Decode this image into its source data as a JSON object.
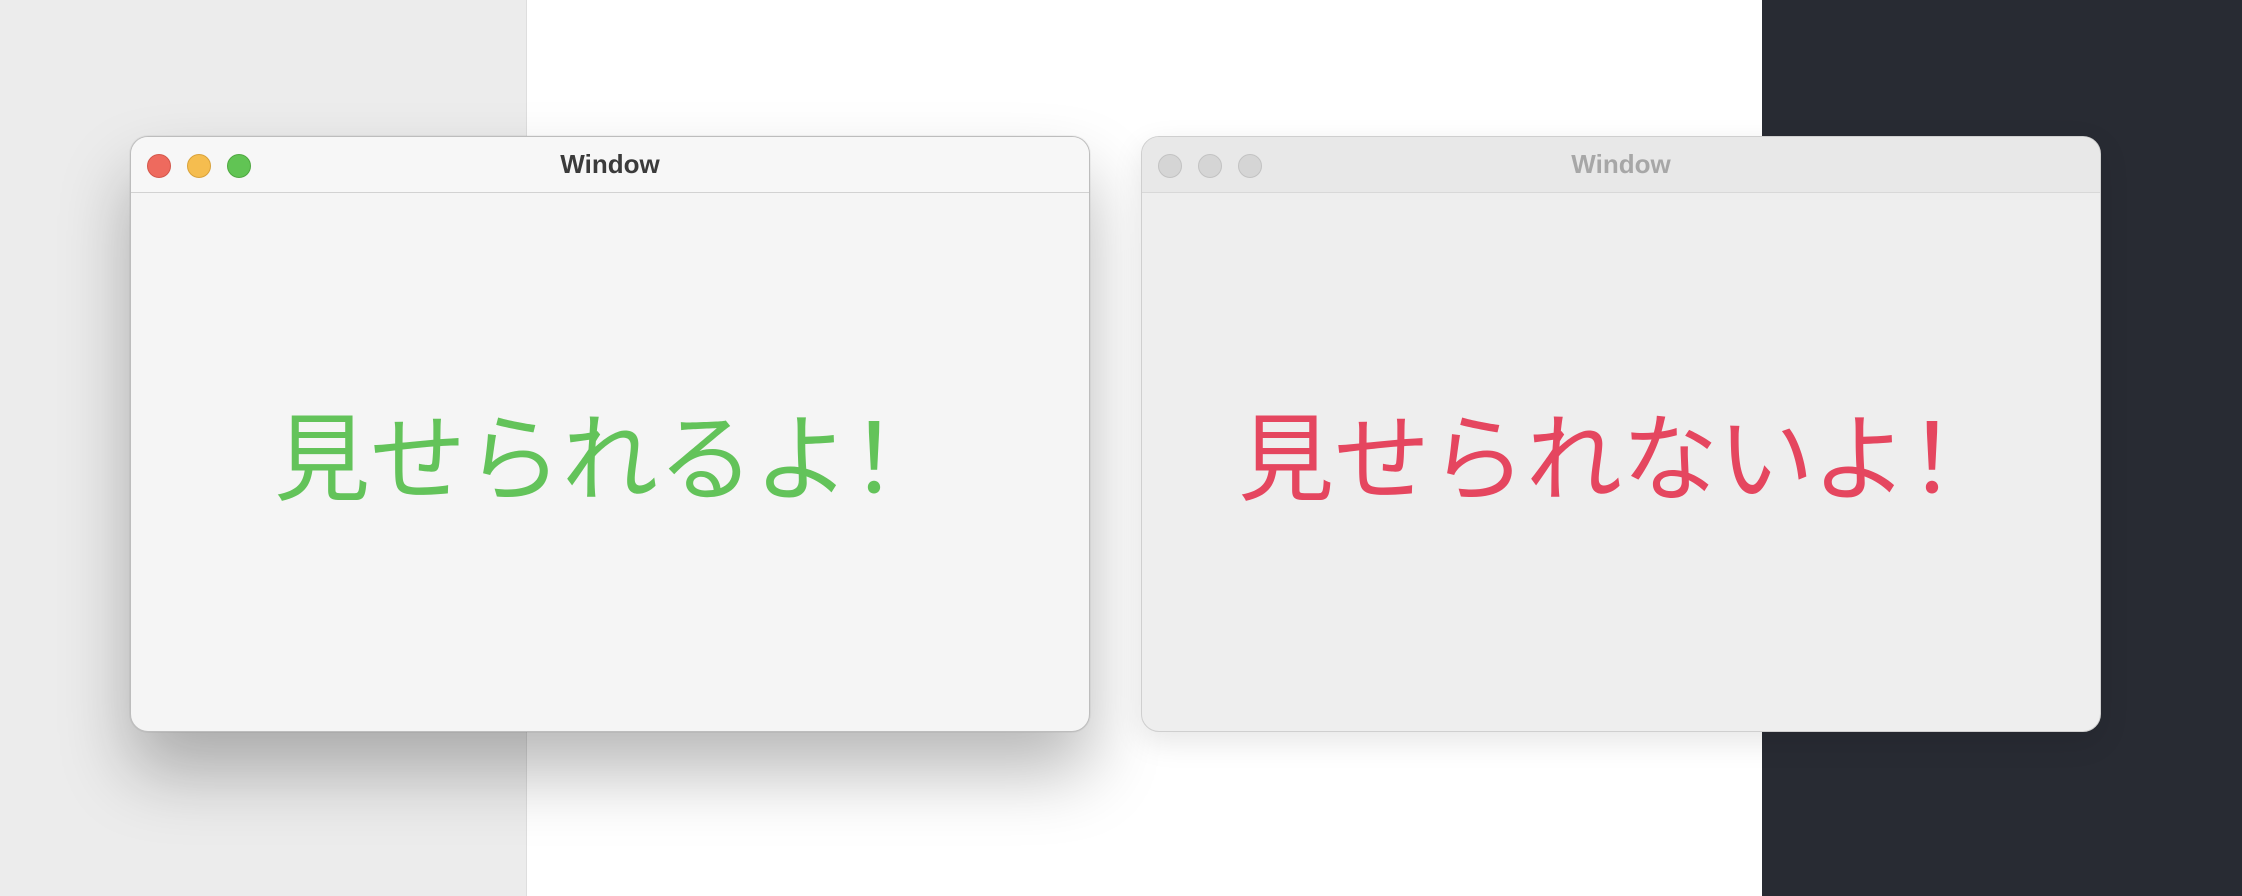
{
  "window_left": {
    "title": "Window",
    "message": "見せられるよ！",
    "state": "active",
    "controls": {
      "close": "close-icon",
      "minimize": "minimize-icon",
      "maximize": "maximize-icon"
    },
    "message_color": "#63c35a"
  },
  "window_right": {
    "title": "Window",
    "message": "見せられないよ！",
    "state": "inactive",
    "controls": {
      "close": "close-icon",
      "minimize": "minimize-icon",
      "maximize": "maximize-icon"
    },
    "message_color": "#e5465f"
  },
  "colors": {
    "background_left": "#ececec",
    "background_middle": "#ffffff",
    "background_right": "#282b33"
  }
}
